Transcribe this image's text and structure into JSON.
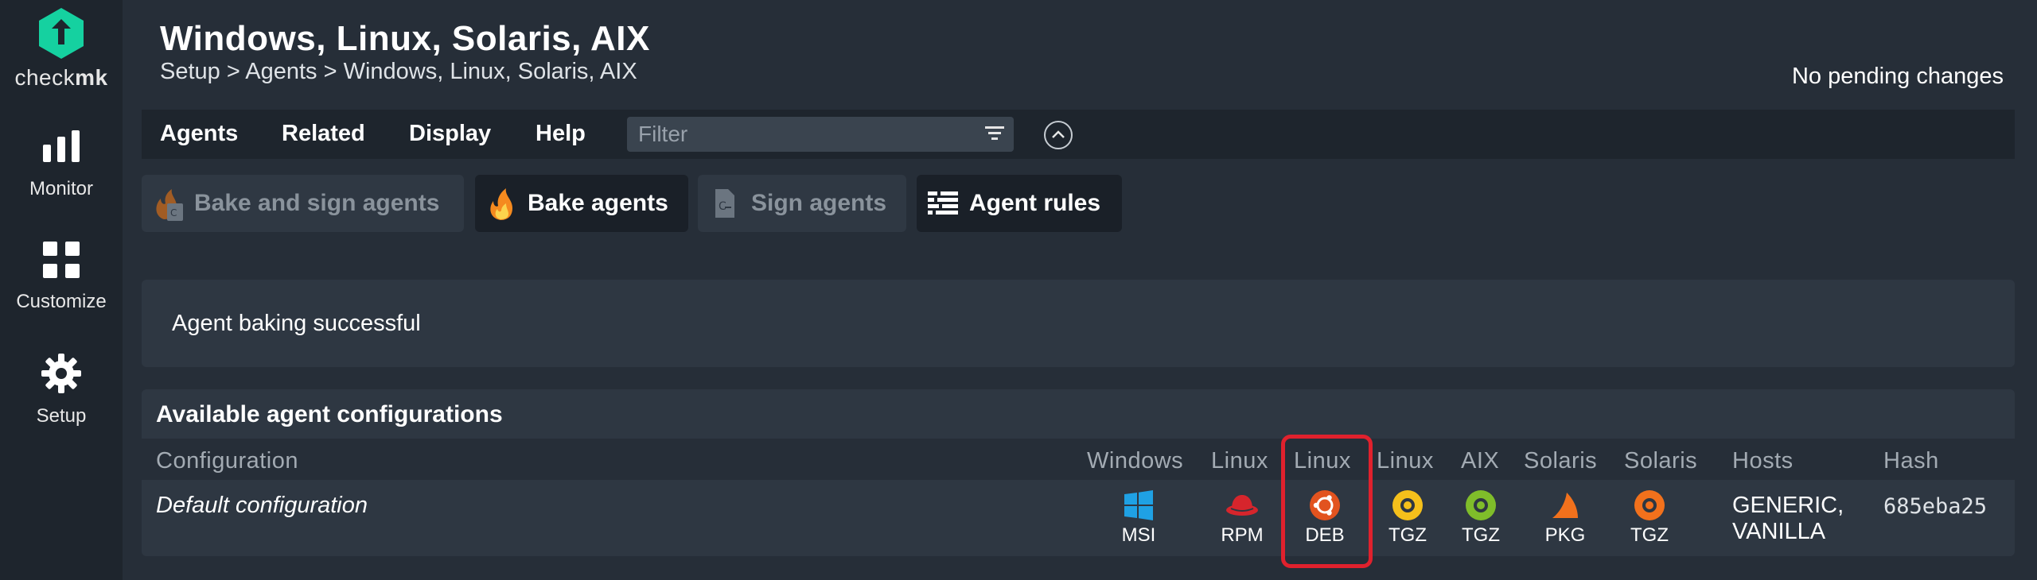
{
  "app": {
    "logo_text_light": "check",
    "logo_text_bold": "mk",
    "brand_color": "#15d1a0"
  },
  "sidebar": {
    "items": [
      {
        "label": "Monitor",
        "icon": "bar-chart-icon"
      },
      {
        "label": "Customize",
        "icon": "grid-icon"
      },
      {
        "label": "Setup",
        "icon": "gear-icon"
      }
    ]
  },
  "header": {
    "title": "Windows, Linux, Solaris, AIX",
    "breadcrumb": "Setup > Agents > Windows, Linux, Solaris, AIX",
    "pending": "No pending changes"
  },
  "menubar": {
    "items": [
      "Agents",
      "Related",
      "Display",
      "Help"
    ],
    "filter_placeholder": "Filter",
    "filter_value": ""
  },
  "actions": [
    {
      "label": "Bake and sign agents",
      "icon": "flame-sign-icon",
      "enabled": false
    },
    {
      "label": "Bake agents",
      "icon": "flame-icon",
      "enabled": true
    },
    {
      "label": "Sign agents",
      "icon": "sign-icon",
      "enabled": false
    },
    {
      "label": "Agent rules",
      "icon": "rules-icon",
      "enabled": true
    }
  ],
  "message": "Agent baking successful",
  "table": {
    "title": "Available agent configurations",
    "columns": [
      "Configuration",
      "Windows",
      "Linux",
      "Linux",
      "Linux",
      "AIX",
      "Solaris",
      "Solaris",
      "Hosts",
      "Hash"
    ],
    "rows": [
      {
        "configuration": "Default configuration",
        "packages": [
          {
            "label": "MSI",
            "icon": "windows-icon"
          },
          {
            "label": "RPM",
            "icon": "redhat-icon"
          },
          {
            "label": "DEB",
            "icon": "ubuntu-icon"
          },
          {
            "label": "TGZ",
            "icon": "tgz-linux-icon"
          },
          {
            "label": "TGZ",
            "icon": "tgz-aix-icon"
          },
          {
            "label": "PKG",
            "icon": "solaris-pkg-icon"
          },
          {
            "label": "TGZ",
            "icon": "tgz-solaris-icon"
          }
        ],
        "hosts_line1": "GENERIC,",
        "hosts_line2": "VANILLA",
        "hash": "685eba25"
      }
    ]
  },
  "colors": {
    "highlight": "#e0212d",
    "windows": "#1fa1e4",
    "redhat": "#d6252c",
    "ubuntu": "#e2531f",
    "tgz_linux": "#f5c01b",
    "tgz_aix": "#7fbd2a",
    "solaris_pkg": "#f2711c",
    "tgz_solaris": "#f2711c"
  }
}
